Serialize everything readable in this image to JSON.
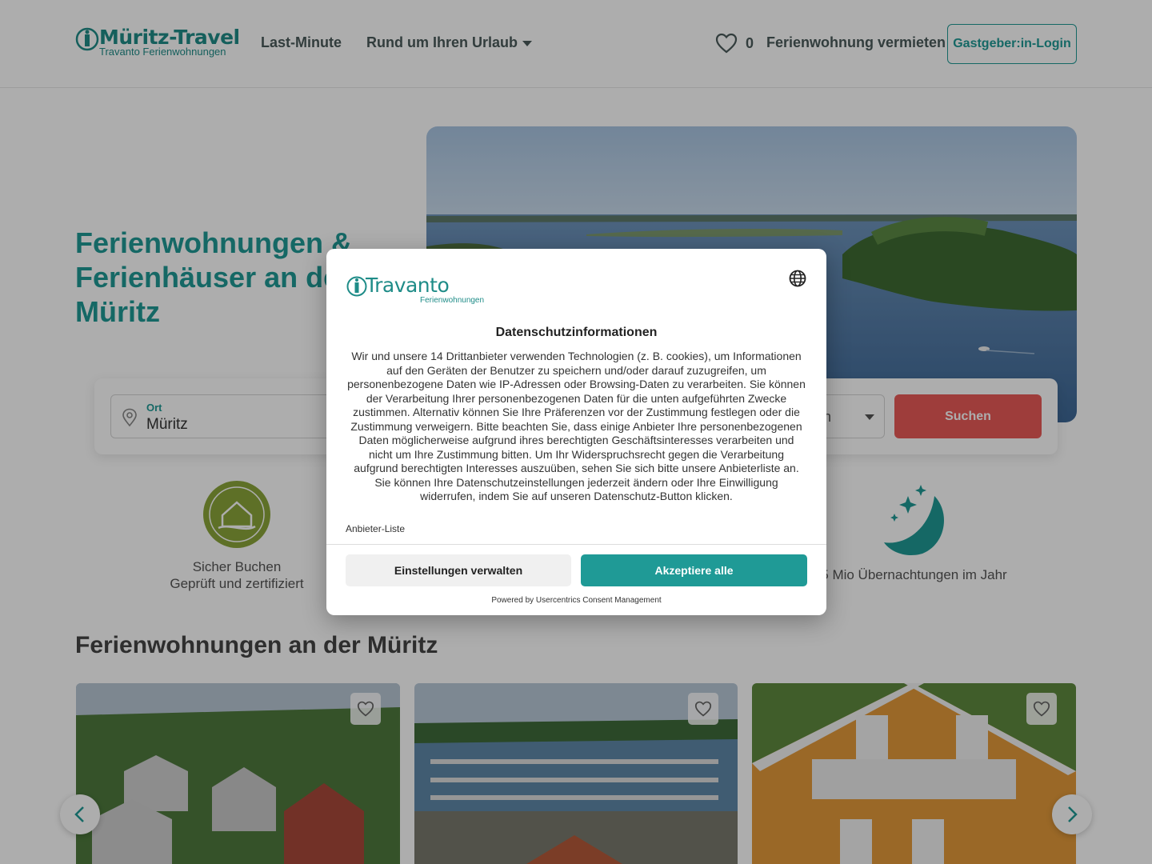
{
  "header": {
    "logo_main": "Müritz-Travel",
    "logo_sub": "Travanto Ferienwohnungen",
    "nav": [
      {
        "label": "Last-Minute"
      },
      {
        "label": "Rund um Ihren Urlaub"
      }
    ],
    "favorites_count": "0",
    "vermieten": "Ferienwohnung vermieten",
    "login": "Gastgeber:in-Login"
  },
  "hero": {
    "title": "Ferienwohnungen & Ferienhäuser an der Müritz"
  },
  "search": {
    "ort_label": "Ort",
    "ort_value": "Müritz",
    "persons_value": "en",
    "button": "Suchen"
  },
  "usps": [
    {
      "line1": "Sicher Buchen",
      "line2": "Geprüft und zertifiziert"
    },
    {
      "line1": "5 Mio Übernachtungen im Jahr",
      "line2": ""
    }
  ],
  "section": {
    "title": "Ferienwohnungen an der Müritz"
  },
  "modal": {
    "logo": "Travanto",
    "logo_sub": "Ferienwohnungen",
    "title": "Datenschutzinformationen",
    "text": "Wir und unsere 14 Drittanbieter verwenden Technologien (z. B. cookies), um Informationen auf den Geräten der Benutzer zu speichern und/oder darauf zuzugreifen, um personenbezogene Daten wie IP-Adressen oder Browsing-Daten zu verarbeiten. Sie können der Verarbeitung Ihrer personenbezogenen Daten für die unten aufgeführten Zwecke zustimmen. Alternativ können Sie Ihre Präferenzen vor der Zustimmung festlegen oder die Zustimmung verweigern. Bitte beachten Sie, dass einige Anbieter Ihre personenbezogenen Daten möglicherweise aufgrund ihres berechtigten Geschäftsinteresses verarbeiten und nicht um Ihre Zustimmung bitten. Um Ihr Widerspruchsrecht gegen die Verarbeitung aufgrund berechtigten Interesses auszuüben, sehen Sie sich bitte unsere Anbieterliste an. Sie können Ihre Datenschutzeinstellungen jederzeit ändern oder Ihre Einwilligung widerrufen, indem Sie auf unseren Datenschutz-Button klicken.",
    "vendor_link": "Anbieter-Liste",
    "btn_settings": "Einstellungen verwalten",
    "btn_accept": "Akzeptiere alle",
    "powered": "Powered by Usercentrics Consent Management"
  },
  "colors": {
    "brand": "#1f9a96",
    "search_button": "#e95b58"
  }
}
